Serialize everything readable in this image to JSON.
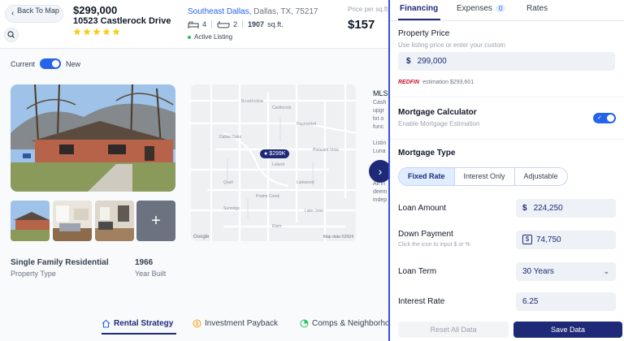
{
  "header": {
    "back_label": "Back To Map",
    "price": "$299,000",
    "address": "10523 Castlerock Drive",
    "rating": 5,
    "location_city": "Southeast Dallas,",
    "location_rest": " Dallas, TX, 75217",
    "beds": "4",
    "baths": "2",
    "sqft_value": "1907",
    "sqft_unit": "sq.ft.",
    "status": "Active Listing",
    "price_per_sqft_label": "Price per sq.ft.",
    "price_per_sqft": "$157",
    "colors": {
      "brand": "#1e2a78",
      "accent": "#2563eb",
      "star": "#facc15",
      "status": "#22c55e"
    }
  },
  "view_toggle": {
    "left_label": "Current",
    "right_label": "New",
    "on": true
  },
  "gallery": {
    "more_icon": "plus-icon"
  },
  "map": {
    "pin_label": "$299K",
    "google": "Google",
    "credit": "Map data ©2024",
    "streets": [
      "Brookhollow",
      "Castlerock",
      "Haymarket",
      "Dallas Oaks",
      "Pleasant Vista",
      "Leland",
      "Quail",
      "Larkwood",
      "Prairie Creek",
      "Sunridge",
      "Lake June",
      "Elam"
    ]
  },
  "mls": {
    "heading": "MLS",
    "lines": [
      "Cash",
      "upgr",
      "lot o",
      "func",
      "",
      "Listin",
      "Luna",
      "",
      "Syste",
      "",
      "All in",
      "deem",
      "indep"
    ]
  },
  "property": {
    "type_value": "Single Family Residential",
    "type_label": "Property Type",
    "year_value": "1966",
    "year_label": "Year Built"
  },
  "bottom_tabs": [
    "Rental Strategy",
    "Investment Payback",
    "Comps & Neighborhood"
  ],
  "panel": {
    "tabs": [
      {
        "label": "Financing"
      },
      {
        "label": "Expenses",
        "badge": "0"
      },
      {
        "label": "Rates"
      }
    ],
    "property_price_title": "Property Price",
    "property_price_sub": "Use listing price or enter your custom",
    "property_price_value": "299,000",
    "redfin_brand": "REDFIN",
    "redfin_estimation": "estimation $293,601",
    "mortgage_calc_title": "Mortgage Calculator",
    "mortgage_calc_sub": "Enable Mortgage Estimation",
    "mortgage_calc_on": true,
    "mortgage_type_title": "Mortgage Type",
    "mortgage_types": [
      "Fixed Rate",
      "Interest Only",
      "Adjustable"
    ],
    "mortgage_type_selected": "Fixed Rate",
    "loan_amount_label": "Loan Amount",
    "loan_amount_value": "224,250",
    "down_payment_label": "Down Payment",
    "down_payment_sub": "Click the icon to input $ or %",
    "down_payment_value": "74,750",
    "loan_term_label": "Loan Term",
    "loan_term_value": "30 Years",
    "interest_rate_label": "Interest Rate",
    "interest_rate_value": "6.25",
    "reset_label": "Reset All Data",
    "save_label": "Save Data"
  }
}
